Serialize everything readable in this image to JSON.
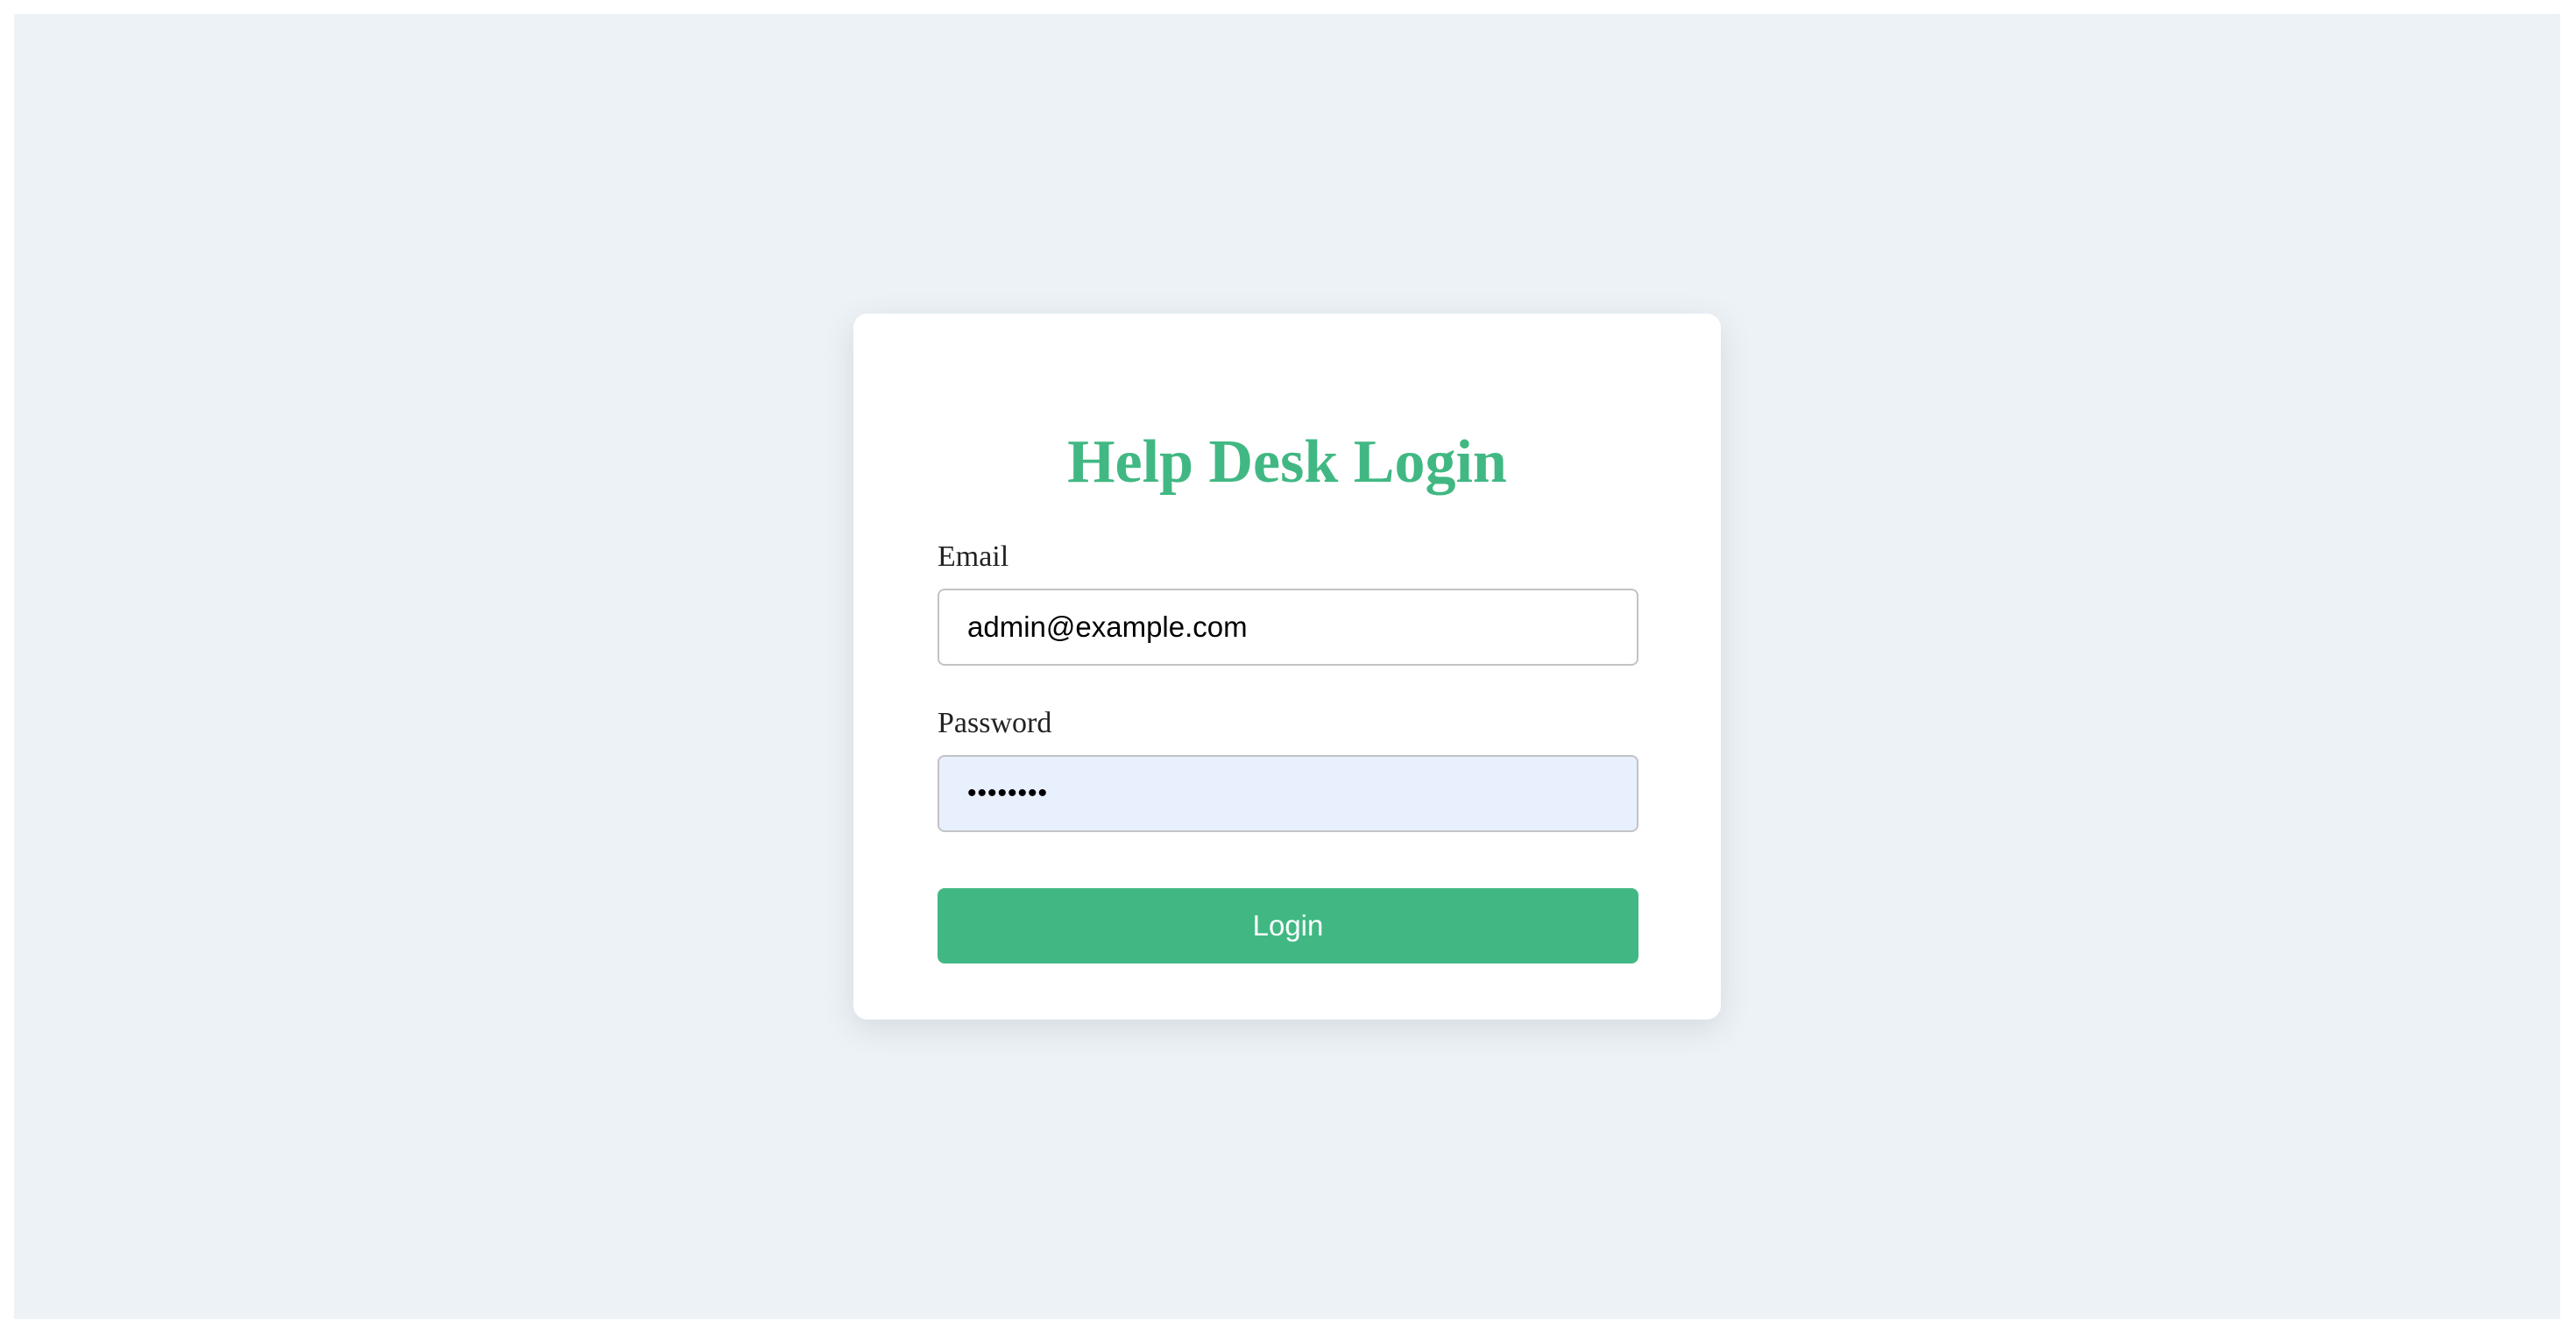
{
  "login": {
    "title": "Help Desk Login",
    "email": {
      "label": "Email",
      "value": "admin@example.com"
    },
    "password": {
      "label": "Password",
      "value": "12345678"
    },
    "submit_label": "Login"
  },
  "colors": {
    "accent": "#41b883",
    "page_background": "#edf2f6",
    "card_background": "#ffffff",
    "autofill_background": "#e8f0fe"
  }
}
